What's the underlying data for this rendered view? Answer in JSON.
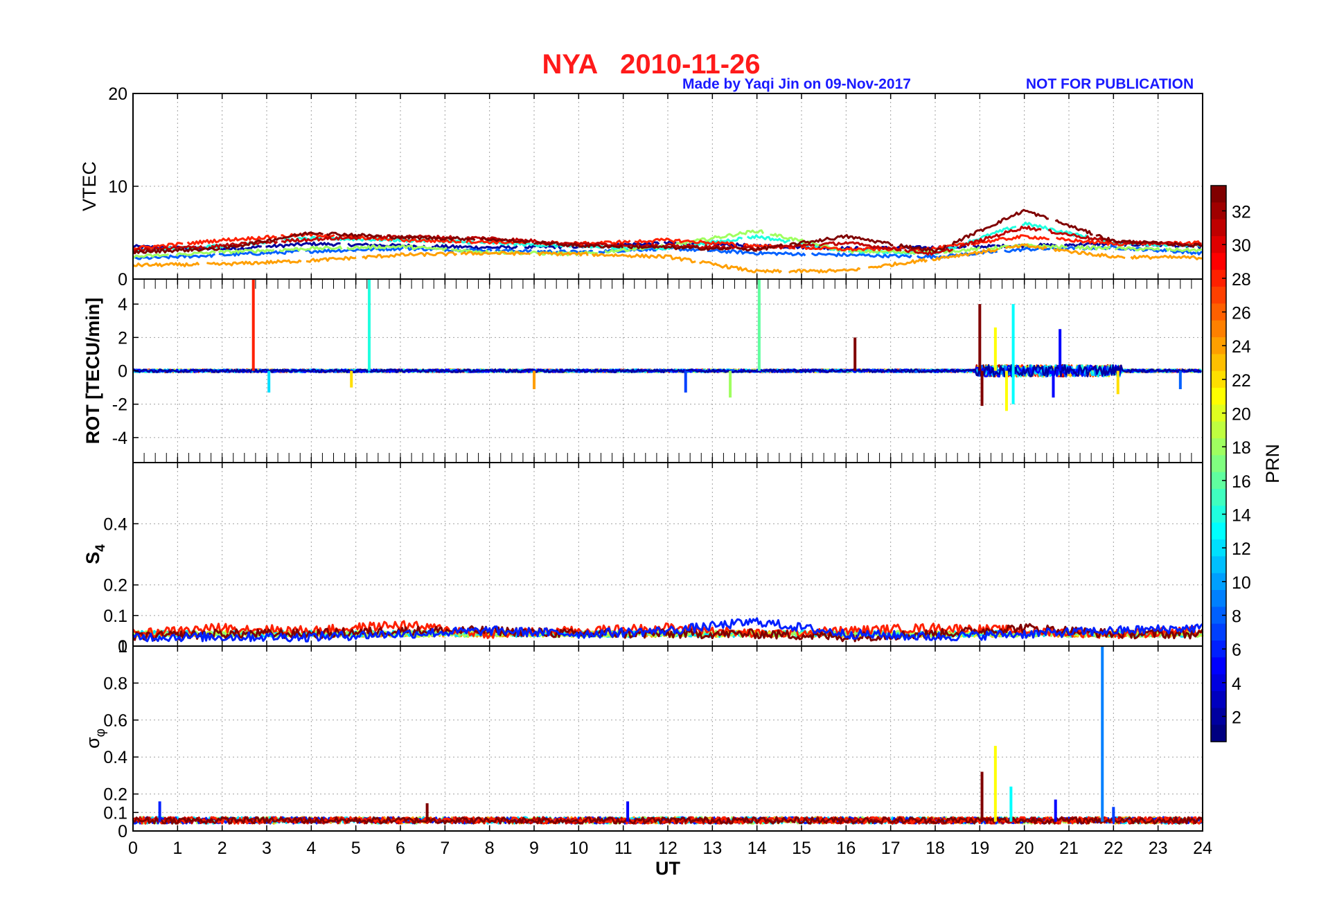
{
  "header": {
    "title": "NYA   2010-11-26",
    "credit": "Made by Yaqi Jin on 09-Nov-2017",
    "notice": "NOT FOR PUBLICATION"
  },
  "colors": {
    "title": "#ff1a1a",
    "credit": "#1a1aff",
    "axis": "#000000",
    "grid": "#a0a0a0"
  },
  "colorbar": {
    "label": "PRN",
    "range": [
      1,
      33
    ],
    "ticks": [
      2,
      4,
      6,
      8,
      10,
      12,
      14,
      16,
      18,
      20,
      22,
      24,
      26,
      28,
      30,
      32
    ],
    "colormap": "jet"
  },
  "chart_data": [
    {
      "type": "line",
      "id": "vtec",
      "ylabel": "VTEC",
      "xlabel": "",
      "xlim": [
        0,
        24
      ],
      "ylim": [
        0,
        20
      ],
      "yticks": [
        0,
        10,
        20
      ],
      "grid": true,
      "series": [
        {
          "prn": 2,
          "x": [
            0,
            2,
            4,
            6,
            8,
            10,
            12,
            14,
            16,
            18,
            20,
            22,
            24
          ],
          "y": [
            3.5,
            3.2,
            3.8,
            3.6,
            3.4,
            3.5,
            3.9,
            3.6,
            3.3,
            3.4,
            3.6,
            3.8,
            3.5
          ]
        },
        {
          "prn": 8,
          "x": [
            0,
            2,
            4,
            6,
            8,
            10,
            12,
            14,
            16,
            18,
            20,
            22,
            24
          ],
          "y": [
            2.2,
            2.6,
            3.0,
            3.3,
            3.1,
            2.9,
            3.3,
            2.8,
            2.6,
            2.4,
            3.2,
            3.4,
            2.8
          ]
        },
        {
          "prn": 14,
          "x": [
            0,
            2,
            4,
            6,
            8,
            10,
            12,
            14,
            16,
            18,
            20,
            22,
            24
          ],
          "y": [
            3.0,
            3.6,
            4.4,
            4.2,
            3.9,
            3.5,
            3.3,
            4.6,
            3.0,
            2.8,
            6.0,
            3.9,
            3.6
          ]
        },
        {
          "prn": 18,
          "x": [
            0,
            2,
            4,
            6,
            8,
            10,
            12,
            14,
            16,
            18,
            20,
            22,
            24
          ],
          "y": [
            2.4,
            2.9,
            3.3,
            3.5,
            2.9,
            2.7,
            3.6,
            5.2,
            3.0,
            2.9,
            3.6,
            3.3,
            3.1
          ]
        },
        {
          "prn": 24,
          "x": [
            0,
            2,
            4,
            6,
            8,
            10,
            12,
            14,
            16,
            18,
            20,
            22,
            24
          ],
          "y": [
            1.5,
            1.6,
            2.0,
            2.6,
            2.8,
            2.7,
            2.4,
            0.8,
            0.9,
            2.2,
            3.6,
            2.4,
            2.3
          ]
        },
        {
          "prn": 28,
          "x": [
            0,
            2,
            4,
            6,
            8,
            10,
            12,
            14,
            16,
            18,
            20,
            22,
            24
          ],
          "y": [
            3.3,
            4.2,
            4.8,
            4.2,
            4.0,
            3.8,
            4.2,
            3.6,
            3.2,
            3.3,
            4.6,
            3.8,
            3.9
          ]
        },
        {
          "prn": 31,
          "x": [
            0,
            2,
            4,
            6,
            8,
            10,
            12,
            14,
            16,
            18,
            20,
            22,
            24
          ],
          "y": [
            3.1,
            3.6,
            4.3,
            4.6,
            4.4,
            3.8,
            3.6,
            3.3,
            3.9,
            2.7,
            5.6,
            4.0,
            3.7
          ]
        },
        {
          "prn": 33,
          "x": [
            0,
            2,
            4,
            6,
            8,
            10,
            12,
            14,
            16,
            18,
            20,
            22,
            24
          ],
          "y": [
            2.9,
            3.3,
            5.0,
            4.5,
            4.3,
            3.6,
            3.4,
            3.2,
            4.6,
            3.0,
            7.4,
            4.1,
            3.6
          ]
        }
      ]
    },
    {
      "type": "line",
      "id": "rot",
      "ylabel": "ROT [TECU/min]",
      "xlabel": "",
      "xlim": [
        0,
        24
      ],
      "ylim": [
        -5.5,
        5.5
      ],
      "yticks": [
        -4,
        -2,
        0,
        2,
        4
      ],
      "grid": true,
      "spikes": [
        {
          "x": 2.7,
          "y": 5.5,
          "prn": 28
        },
        {
          "x": 5.3,
          "y": 5.5,
          "prn": 14
        },
        {
          "x": 14.05,
          "y": 5.5,
          "prn": 16
        },
        {
          "x": 16.2,
          "y": 2.0,
          "prn": 33
        },
        {
          "x": 19.0,
          "y": 4.0,
          "prn": 33
        },
        {
          "x": 19.05,
          "y": -2.1,
          "prn": 33
        },
        {
          "x": 19.35,
          "y": 2.6,
          "prn": 21
        },
        {
          "x": 19.6,
          "y": -2.4,
          "prn": 21
        },
        {
          "x": 19.75,
          "y": 4.0,
          "prn": 13
        },
        {
          "x": 19.75,
          "y": -2.0,
          "prn": 13
        },
        {
          "x": 20.8,
          "y": 2.5,
          "prn": 5
        },
        {
          "x": 20.65,
          "y": -1.6,
          "prn": 5
        },
        {
          "x": 13.4,
          "y": -1.6,
          "prn": 18
        },
        {
          "x": 12.4,
          "y": -1.3,
          "prn": 7
        },
        {
          "x": 3.05,
          "y": -1.3,
          "prn": 12
        },
        {
          "x": 9.0,
          "y": -1.1,
          "prn": 24
        },
        {
          "x": 4.9,
          "y": -1.0,
          "prn": 22
        },
        {
          "x": 23.5,
          "y": -1.1,
          "prn": 8
        },
        {
          "x": 22.1,
          "y": -1.4,
          "prn": 22
        }
      ]
    },
    {
      "type": "line",
      "id": "s4",
      "ylabel": "S4",
      "xlabel": "",
      "xlim": [
        0,
        24
      ],
      "ylim": [
        0,
        0.6
      ],
      "yticks": [
        0,
        0.1,
        0.2,
        0.4
      ],
      "grid": true,
      "series_levels": [
        {
          "prn": 28,
          "x": [
            0,
            2,
            4,
            6,
            8,
            10,
            12,
            14,
            16,
            18,
            20,
            22,
            24
          ],
          "y": [
            0.04,
            0.06,
            0.05,
            0.07,
            0.04,
            0.05,
            0.06,
            0.04,
            0.05,
            0.06,
            0.05,
            0.04,
            0.05
          ]
        },
        {
          "prn": 33,
          "x": [
            0,
            2,
            4,
            6,
            8,
            10,
            12,
            14,
            16,
            18,
            20,
            22,
            24
          ],
          "y": [
            0.03,
            0.04,
            0.04,
            0.05,
            0.05,
            0.04,
            0.04,
            0.04,
            0.03,
            0.04,
            0.06,
            0.04,
            0.04
          ]
        },
        {
          "prn": 6,
          "x": [
            0,
            2,
            4,
            6,
            8,
            10,
            12,
            14,
            16,
            18,
            20,
            22,
            24
          ],
          "y": [
            0.03,
            0.03,
            0.03,
            0.04,
            0.05,
            0.04,
            0.05,
            0.08,
            0.04,
            0.03,
            0.04,
            0.05,
            0.06
          ]
        }
      ]
    },
    {
      "type": "line",
      "id": "sigma_phi",
      "ylabel": "σφ",
      "xlabel": "UT",
      "xlim": [
        0,
        24
      ],
      "ylim": [
        0,
        1
      ],
      "yticks": [
        0,
        0.1,
        0.2,
        0.4,
        0.6,
        0.8,
        1
      ],
      "xticks": [
        0,
        1,
        2,
        3,
        4,
        5,
        6,
        7,
        8,
        9,
        10,
        11,
        12,
        13,
        14,
        15,
        16,
        17,
        18,
        19,
        20,
        21,
        22,
        23,
        24
      ],
      "grid": true,
      "spikes": [
        {
          "x": 21.75,
          "y": 1.0,
          "prn": 9
        },
        {
          "x": 19.35,
          "y": 0.46,
          "prn": 21
        },
        {
          "x": 19.05,
          "y": 0.32,
          "prn": 33
        },
        {
          "x": 19.7,
          "y": 0.24,
          "prn": 13
        },
        {
          "x": 0.6,
          "y": 0.16,
          "prn": 6
        },
        {
          "x": 11.1,
          "y": 0.16,
          "prn": 5
        },
        {
          "x": 20.7,
          "y": 0.17,
          "prn": 5
        },
        {
          "x": 6.6,
          "y": 0.15,
          "prn": 33
        },
        {
          "x": 22.0,
          "y": 0.13,
          "prn": 7
        }
      ]
    }
  ]
}
